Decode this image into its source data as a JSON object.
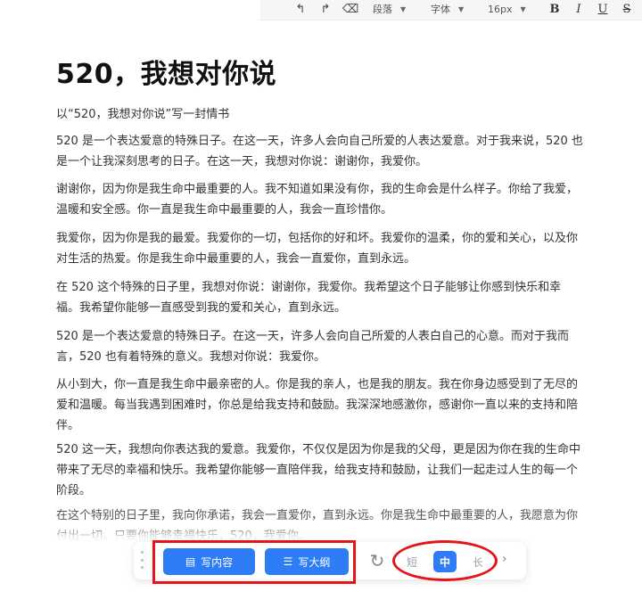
{
  "toolbar": {
    "undo_icon": "undo-icon",
    "redo_icon": "redo-icon",
    "clear_format_icon": "eraser-icon",
    "paragraph_label": "段落",
    "font_label": "字体",
    "font_size_label": "16px",
    "bold_label": "B",
    "italic_label": "I",
    "underline_label": "U",
    "strike_label": "S"
  },
  "document": {
    "title": "520，我想对你说",
    "subtitle": "以“520，我想对你说”写一封情书",
    "paragraphs": [
      "520 是一个表达爱意的特殊日子。在这一天，许多人会向自己所爱的人表达爱意。对于我来说，520 也是一个让我深刻思考的日子。在这一天，我想对你说：谢谢你，我爱你。",
      "谢谢你，因为你是我生命中最重要的人。我不知道如果没有你，我的生命会是什么样子。你给了我爱，温暖和安全感。你一直是我生命中最重要的人，我会一直珍惜你。",
      "我爱你，因为你是我的最爱。我爱你的一切，包括你的好和坏。我爱你的温柔，你的爱和关心，以及你对生活的热爱。你是我生命中最重要的人，我会一直爱你，直到永远。",
      "在 520 这个特殊的日子里，我想对你说：谢谢你，我爱你。我希望这个日子能够让你感到快乐和幸福。我希望你能够一直感受到我的爱和关心，直到永远。",
      "520 是一个表达爱意的特殊日子。在这一天，许多人会向自己所爱的人表白自己的心意。而对于我而言，520 也有着特殊的意义。我想对你说：我爱你。",
      "从小到大，你一直是我生命中最亲密的人。你是我的亲人，也是我的朋友。我在你身边感受到了无尽的爱和温暖。每当我遇到困难时，你总是给我支持和鼓励。我深深地感激你，感谢你一直以来的支持和陪伴。",
      "520 这一天，我想向你表达我的爱意。我爱你，不仅仅是因为你是我的父母，更是因为你在我的生命中带来了无尽的幸福和快乐。我希望你能够一直陪伴我，给我支持和鼓励，让我们一起走过人生的每一个阶段。",
      "在这个特别的日子里，我向你承诺，我会一直爱你，直到永远。你是我生命中最重要的人，我愿意为你付出一切。只要你能够幸福快乐，520，我爱你。"
    ]
  },
  "bottom_bar": {
    "drag_icon": "drag-handle-icon",
    "write_content_label": "写内容",
    "write_content_icon": "document-icon",
    "write_outline_label": "写大纲",
    "write_outline_icon": "list-icon",
    "refresh_icon": "refresh-icon",
    "length_options": [
      "短",
      "中",
      "长"
    ],
    "length_selected": "中",
    "more_icon": "chevron-right-icon"
  },
  "colors": {
    "accent": "#2e7cf6",
    "annotation": "#e3141a"
  }
}
